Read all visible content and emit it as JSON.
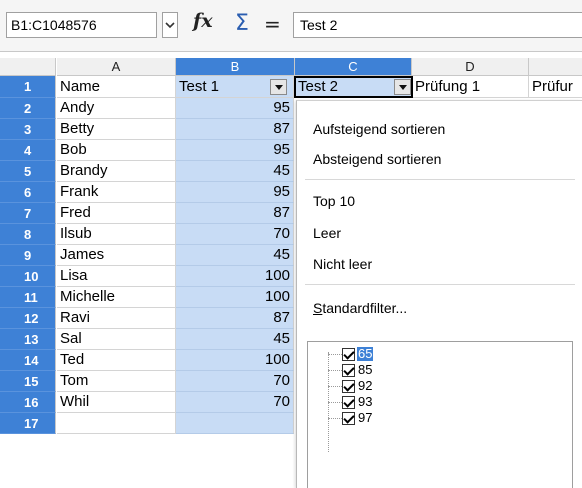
{
  "formula_bar": {
    "name_box": "B1:C1048576",
    "function_wizard_icon": "fx-icon",
    "sum_icon": "sigma-icon",
    "formula_icon": "equals-icon",
    "formula_value": "Test 2"
  },
  "columns": [
    "A",
    "B",
    "C",
    "D"
  ],
  "header_row": {
    "row_number": "1",
    "a": "Name",
    "b": "Test 1",
    "c": "Test 2",
    "d": "Prüfung 1",
    "e": "Prüfur"
  },
  "rows": [
    {
      "num": "2",
      "name": "Andy",
      "test1": "95"
    },
    {
      "num": "3",
      "name": "Betty",
      "test1": "87"
    },
    {
      "num": "4",
      "name": "Bob",
      "test1": "95"
    },
    {
      "num": "5",
      "name": "Brandy",
      "test1": "45"
    },
    {
      "num": "6",
      "name": "Frank",
      "test1": "95"
    },
    {
      "num": "7",
      "name": "Fred",
      "test1": "87"
    },
    {
      "num": "8",
      "name": "Ilsub",
      "test1": "70"
    },
    {
      "num": "9",
      "name": "James",
      "test1": "45"
    },
    {
      "num": "10",
      "name": "Lisa",
      "test1": "100"
    },
    {
      "num": "11",
      "name": "Michelle",
      "test1": "100"
    },
    {
      "num": "12",
      "name": "Ravi",
      "test1": "87"
    },
    {
      "num": "13",
      "name": "Sal",
      "test1": "45"
    },
    {
      "num": "14",
      "name": "Ted",
      "test1": "100"
    },
    {
      "num": "15",
      "name": "Tom",
      "test1": "70"
    },
    {
      "num": "16",
      "name": "Whil",
      "test1": "70"
    },
    {
      "num": "17",
      "name": "",
      "test1": ""
    }
  ],
  "autofilter_menu": {
    "sort_ascending": "Aufsteigend sortieren",
    "sort_descending": "Absteigend sortieren",
    "top10": "Top 10",
    "empty": "Leer",
    "not_empty": "Nicht leer",
    "standard_filter_first": "S",
    "standard_filter_rest": "tandardfilter...",
    "values": [
      {
        "label": "65",
        "checked": true,
        "selected": true
      },
      {
        "label": "85",
        "checked": true,
        "selected": false
      },
      {
        "label": "92",
        "checked": true,
        "selected": false
      },
      {
        "label": "93",
        "checked": true,
        "selected": false
      },
      {
        "label": "97",
        "checked": true,
        "selected": false
      }
    ]
  },
  "colors": {
    "selection_header": "#3e81d6",
    "selection_fill": "#c8dcf5"
  }
}
